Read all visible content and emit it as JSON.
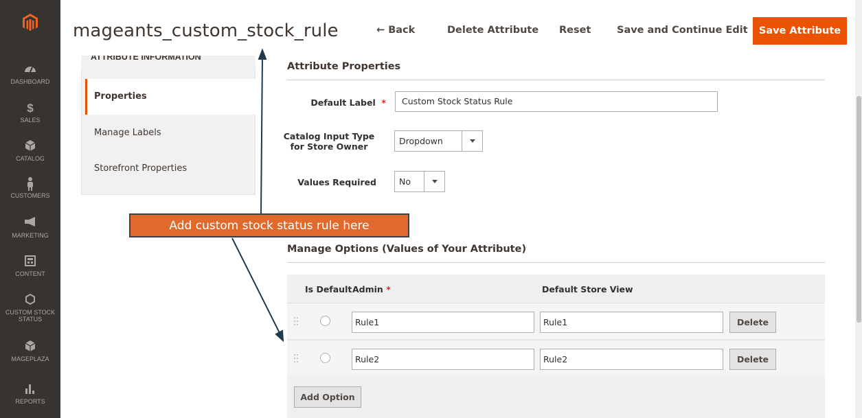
{
  "colors": {
    "accent": "#eb5202",
    "sidebar_bg": "#373330",
    "callout_bg": "#df6a2c"
  },
  "sidebar": {
    "logo": "magento-logo-icon",
    "items": [
      {
        "label": "DASHBOARD",
        "icon": "dashboard-icon"
      },
      {
        "label": "SALES",
        "icon": "dollar-icon"
      },
      {
        "label": "CATALOG",
        "icon": "cube-icon"
      },
      {
        "label": "CUSTOMERS",
        "icon": "person-icon"
      },
      {
        "label": "MARKETING",
        "icon": "megaphone-icon"
      },
      {
        "label": "CONTENT",
        "icon": "layout-icon"
      },
      {
        "label": "CUSTOM STOCK",
        "label2": "STATUS",
        "icon": "hexagon-icon"
      },
      {
        "label": "MAGEPLAZA",
        "icon": "cube-icon"
      },
      {
        "label": "REPORTS",
        "icon": "bar-chart-icon"
      }
    ]
  },
  "header": {
    "title": "mageants_custom_stock_rule",
    "back": "← Back",
    "delete": "Delete Attribute",
    "reset": "Reset",
    "save_continue": "Save and Continue Edit",
    "save": "Save Attribute"
  },
  "tabs": {
    "title": "ATTRIBUTE INFORMATION",
    "items": [
      "Properties",
      "Manage Labels",
      "Storefront Properties"
    ]
  },
  "properties": {
    "section_title": "Attribute Properties",
    "default_label": {
      "label": "Default Label",
      "req": "*",
      "value": "Custom Stock Status Rule"
    },
    "input_type": {
      "label1": "Catalog Input Type",
      "label2": "for Store Owner",
      "value": "Dropdown"
    },
    "values_required": {
      "label": "Values Required",
      "value": "No"
    }
  },
  "options": {
    "section_title": "Manage Options (Values of Your Attribute)",
    "col_default": "Is Default",
    "col_admin": "Admin",
    "req": "*",
    "col_store": "Default Store View",
    "rows": [
      {
        "admin": "Rule1",
        "store": "Rule1",
        "delete": "Delete"
      },
      {
        "admin": "Rule2",
        "store": "Rule2",
        "delete": "Delete"
      }
    ],
    "add_button": "Add Option"
  },
  "annotation": {
    "text": "Add custom stock status rule here"
  }
}
